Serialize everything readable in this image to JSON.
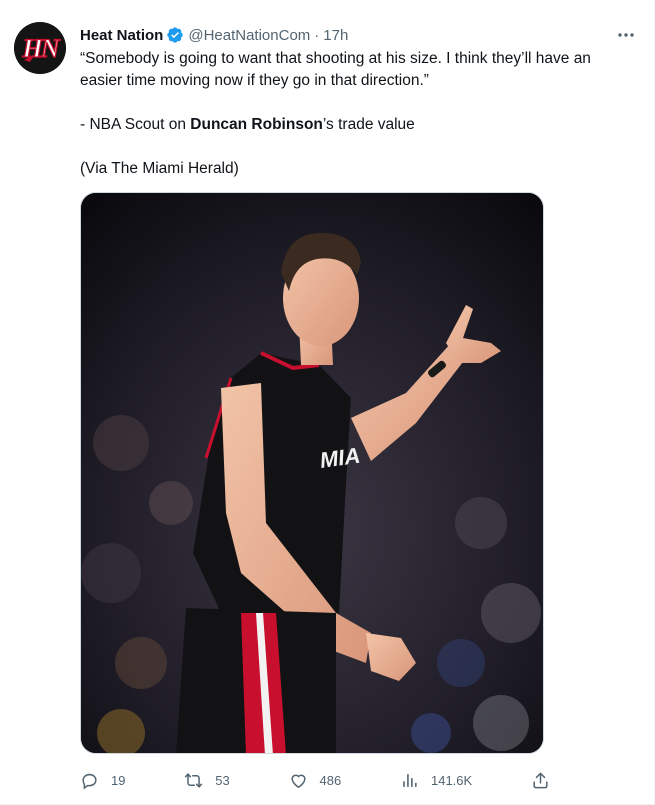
{
  "tweet": {
    "author_name": "Heat Nation",
    "handle": "@HeatNationCom",
    "separator": "·",
    "time": "17h",
    "avatar_icon": "heat-nation-logo",
    "text": {
      "quote": "“Somebody is going to want that shooting at his size. I think they’ll have an easier time moving now if they go in that direction.”",
      "attribution_prefix": "- NBA Scout on ",
      "attribution_bold": "Duncan Robinson",
      "attribution_suffix": "’s trade value",
      "via": "(Via The Miami Herald)"
    },
    "actions": {
      "replies": "19",
      "reposts": "53",
      "likes": "486",
      "views": "141.6K"
    }
  },
  "colors": {
    "verified": "#1d9bf0",
    "text_primary": "#0f1419",
    "text_secondary": "#536471",
    "border": "#cfd9de",
    "heat_red": "#c8102e"
  }
}
